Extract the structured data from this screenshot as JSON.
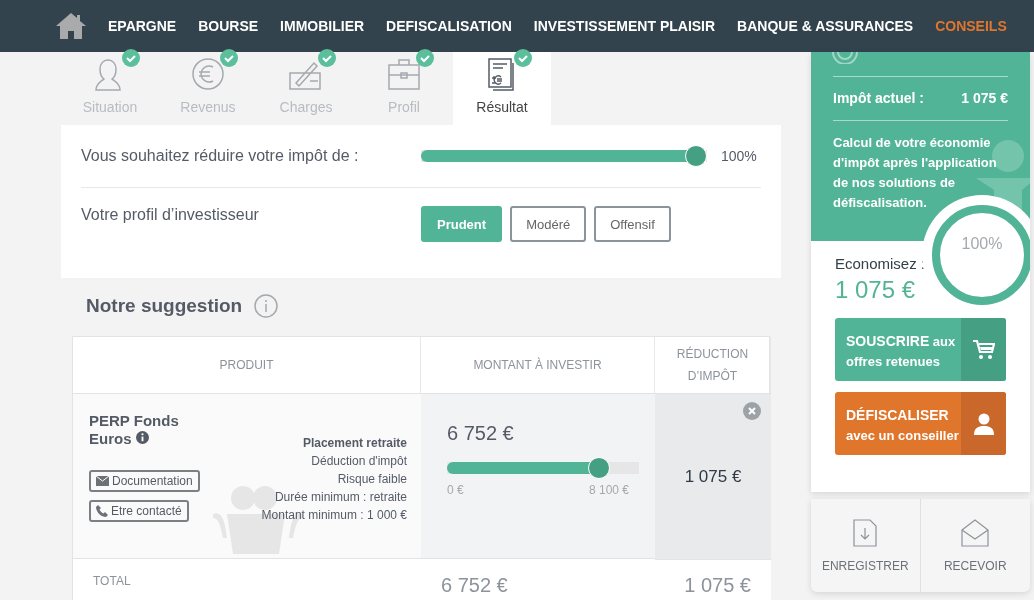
{
  "nav": {
    "items": [
      {
        "label": "EPARGNE",
        "selected": false
      },
      {
        "label": "BOURSE",
        "selected": false
      },
      {
        "label": "IMMOBILIER",
        "selected": false
      },
      {
        "label": "DEFISCALISATION",
        "selected": false
      },
      {
        "label": "INVESTISSEMENT PLAISIR",
        "selected": false
      },
      {
        "label": "BANQUE & ASSURANCES",
        "selected": false
      },
      {
        "label": "CONSEILS",
        "selected": true
      }
    ]
  },
  "steps": [
    {
      "kind": "person",
      "label": "Situation",
      "done": true,
      "selected": false
    },
    {
      "kind": "euro",
      "label": "Revenus",
      "done": true,
      "selected": false
    },
    {
      "kind": "cheque",
      "label": "Charges",
      "done": true,
      "selected": false
    },
    {
      "kind": "briefcase",
      "label": "Profil",
      "done": true,
      "selected": false
    },
    {
      "kind": "result",
      "label": "Résultat",
      "done": true,
      "selected": true
    }
  ],
  "tax_goal": {
    "label": "Vous souhaitez réduire votre impôt de :",
    "level": 1,
    "reading": "100%"
  },
  "investor_profile": {
    "label": "Votre profil d’investisseur",
    "options": [
      {
        "label": "Prudent",
        "selected": true
      },
      {
        "label": "Modéré",
        "selected": false
      },
      {
        "label": "Offensif",
        "selected": false
      }
    ]
  },
  "suggestion": {
    "title": "Notre suggestion",
    "table": {
      "columns": [
        "PRODUIT",
        "MONTANT À INVESTIR",
        "RÉDUCTION D’IMPÔT"
      ],
      "rows": [
        {
          "product": "PERP Fonds Euros",
          "feature_title": "Placement retraite",
          "features": [
            "Déduction d'impôt",
            "Risque faible",
            "Durée minimum : retraite",
            "Montant minimum : 1 000 €"
          ],
          "actions": [
            {
              "kind": "mail",
              "label": "Documentation"
            },
            {
              "kind": "phone",
              "label": "Etre contacté"
            }
          ],
          "amount": "6 752 €",
          "level": 0.83,
          "min": "0 €",
          "max": "8 100 €",
          "reduction": "1 075 €"
        }
      ],
      "total": {
        "label": "TOTAL",
        "amount": "6 752 €",
        "reduction": "1 075 €"
      }
    }
  },
  "sidebar": {
    "current_tax": {
      "label": "Impôt actuel :",
      "value": "1 075 €"
    },
    "description": "Calcul de votre économie d'impôt après l'application de nos solutions de défiscalisation.",
    "gauge": {
      "level": 1,
      "reading": "100%"
    },
    "savings": {
      "label": "Economisez :",
      "value": "1 075 €"
    },
    "buttons": [
      {
        "kind": "cart",
        "title": "SOUSCRIRE",
        "subtitle": "aux offres retenues"
      },
      {
        "kind": "advisor",
        "title": "DÉFISCALISER",
        "subtitle": "avec un conseiller"
      }
    ],
    "actions": [
      {
        "kind": "save",
        "label": "ENREGISTRER"
      },
      {
        "kind": "receive",
        "label": "RECEVOIR"
      }
    ]
  }
}
